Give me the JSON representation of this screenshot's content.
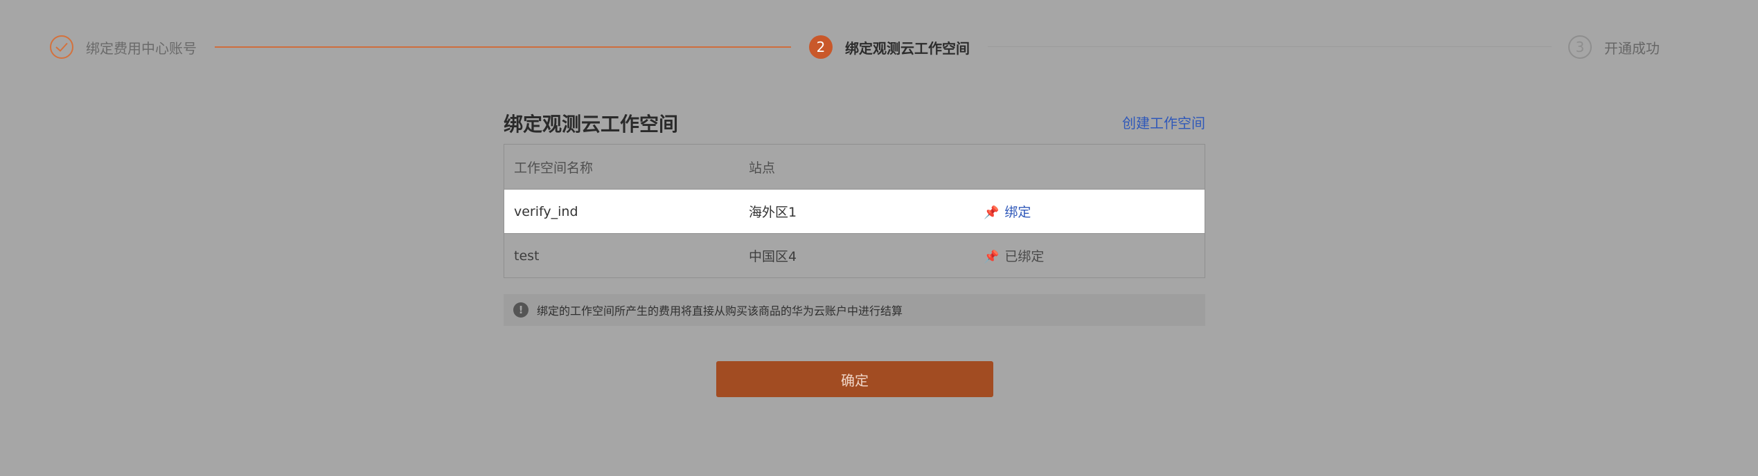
{
  "stepper": {
    "steps": [
      {
        "number": "✓",
        "label": "绑定费用中心账号",
        "state": "done"
      },
      {
        "number": "2",
        "label": "绑定观测云工作空间",
        "state": "active"
      },
      {
        "number": "3",
        "label": "开通成功",
        "state": "pending"
      }
    ]
  },
  "panel": {
    "title": "绑定观测云工作空间",
    "create_link": "创建工作空间",
    "table": {
      "headers": [
        "工作空间名称",
        "站点",
        ""
      ],
      "rows": [
        {
          "name": "verify_ind",
          "site": "海外区1",
          "action": "绑定",
          "action_icon": "pin-icon",
          "bound": false
        },
        {
          "name": "test",
          "site": "中国区4",
          "action": "已绑定",
          "action_icon": "pin-icon",
          "bound": true
        }
      ]
    },
    "notice": {
      "icon": "!",
      "text": "绑定的工作空间所产生的费用将直接从购买该商品的华为云账户中进行结算"
    }
  },
  "confirm_button": "确定",
  "colors": {
    "accent": "#c9582a",
    "link": "#2f58b9",
    "overlay": "#a6a6a6"
  }
}
